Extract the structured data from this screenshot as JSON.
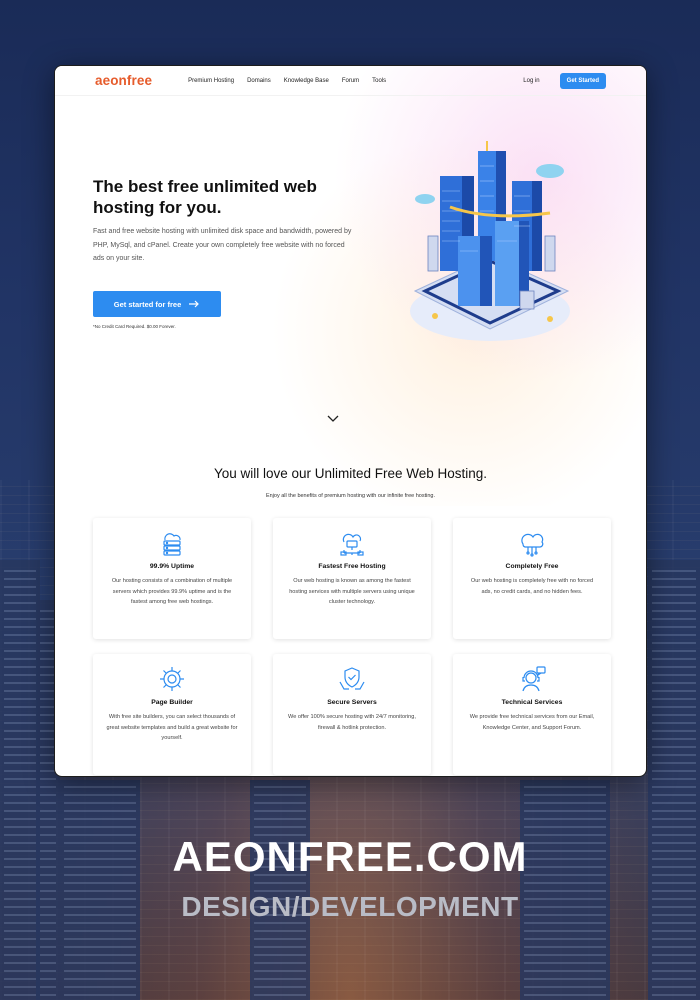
{
  "brand": {
    "logo": "aeonfree",
    "accent": "#e65c2c",
    "primary": "#2d8cf0"
  },
  "nav": {
    "links": [
      "Premium Hosting",
      "Domains",
      "Knowledge Base",
      "Forum",
      "Tools"
    ],
    "login": "Log in",
    "cta": "Get Started"
  },
  "hero": {
    "title": "The best free unlimited web hosting for you.",
    "description": "Fast and free website hosting with unlimited disk space and bandwidth, powered by PHP, MySql, and cPanel. Create your own completely free website with no forced ads on your site.",
    "button": "Get started for free",
    "note": "*No Credit Card Required. $0.00 Forever."
  },
  "features_section": {
    "title": "You will love our Unlimited Free Web Hosting.",
    "subtitle": "Enjoy all the benefits of premium hosting with our infinite free hosting.",
    "items": [
      {
        "icon": "cloud-server-icon",
        "title": "99.9% Uptime",
        "text": "Our hosting consists of a combination of multiple servers which provides 99.9% uptime and is the fastest among free web hostings."
      },
      {
        "icon": "cloud-network-icon",
        "title": "Fastest Free Hosting",
        "text": "Our web hosting is known as among the fastest hosting services with multiple servers using unique cluster technology."
      },
      {
        "icon": "cloud-tree-icon",
        "title": "Completely Free",
        "text": "Our web hosting is completely free with no forced ads, no credit cards, and no hidden fees."
      },
      {
        "icon": "gear-icon",
        "title": "Page Builder",
        "text": "With free site builders, you can select thousands of great website templates and build a great website for yourself."
      },
      {
        "icon": "shield-hands-icon",
        "title": "Secure Servers",
        "text": "We offer 100% secure hosting with 24/7 monitoring, firewall & hotlink protection."
      },
      {
        "icon": "support-agent-icon",
        "title": "Technical Services",
        "text": "We provide free technical services from our Email, Knowledge Center, and Support Forum."
      }
    ]
  },
  "footer": {
    "title": "AEONFREE.COM",
    "subtitle": "DESIGN/DEVELOPMENT"
  }
}
